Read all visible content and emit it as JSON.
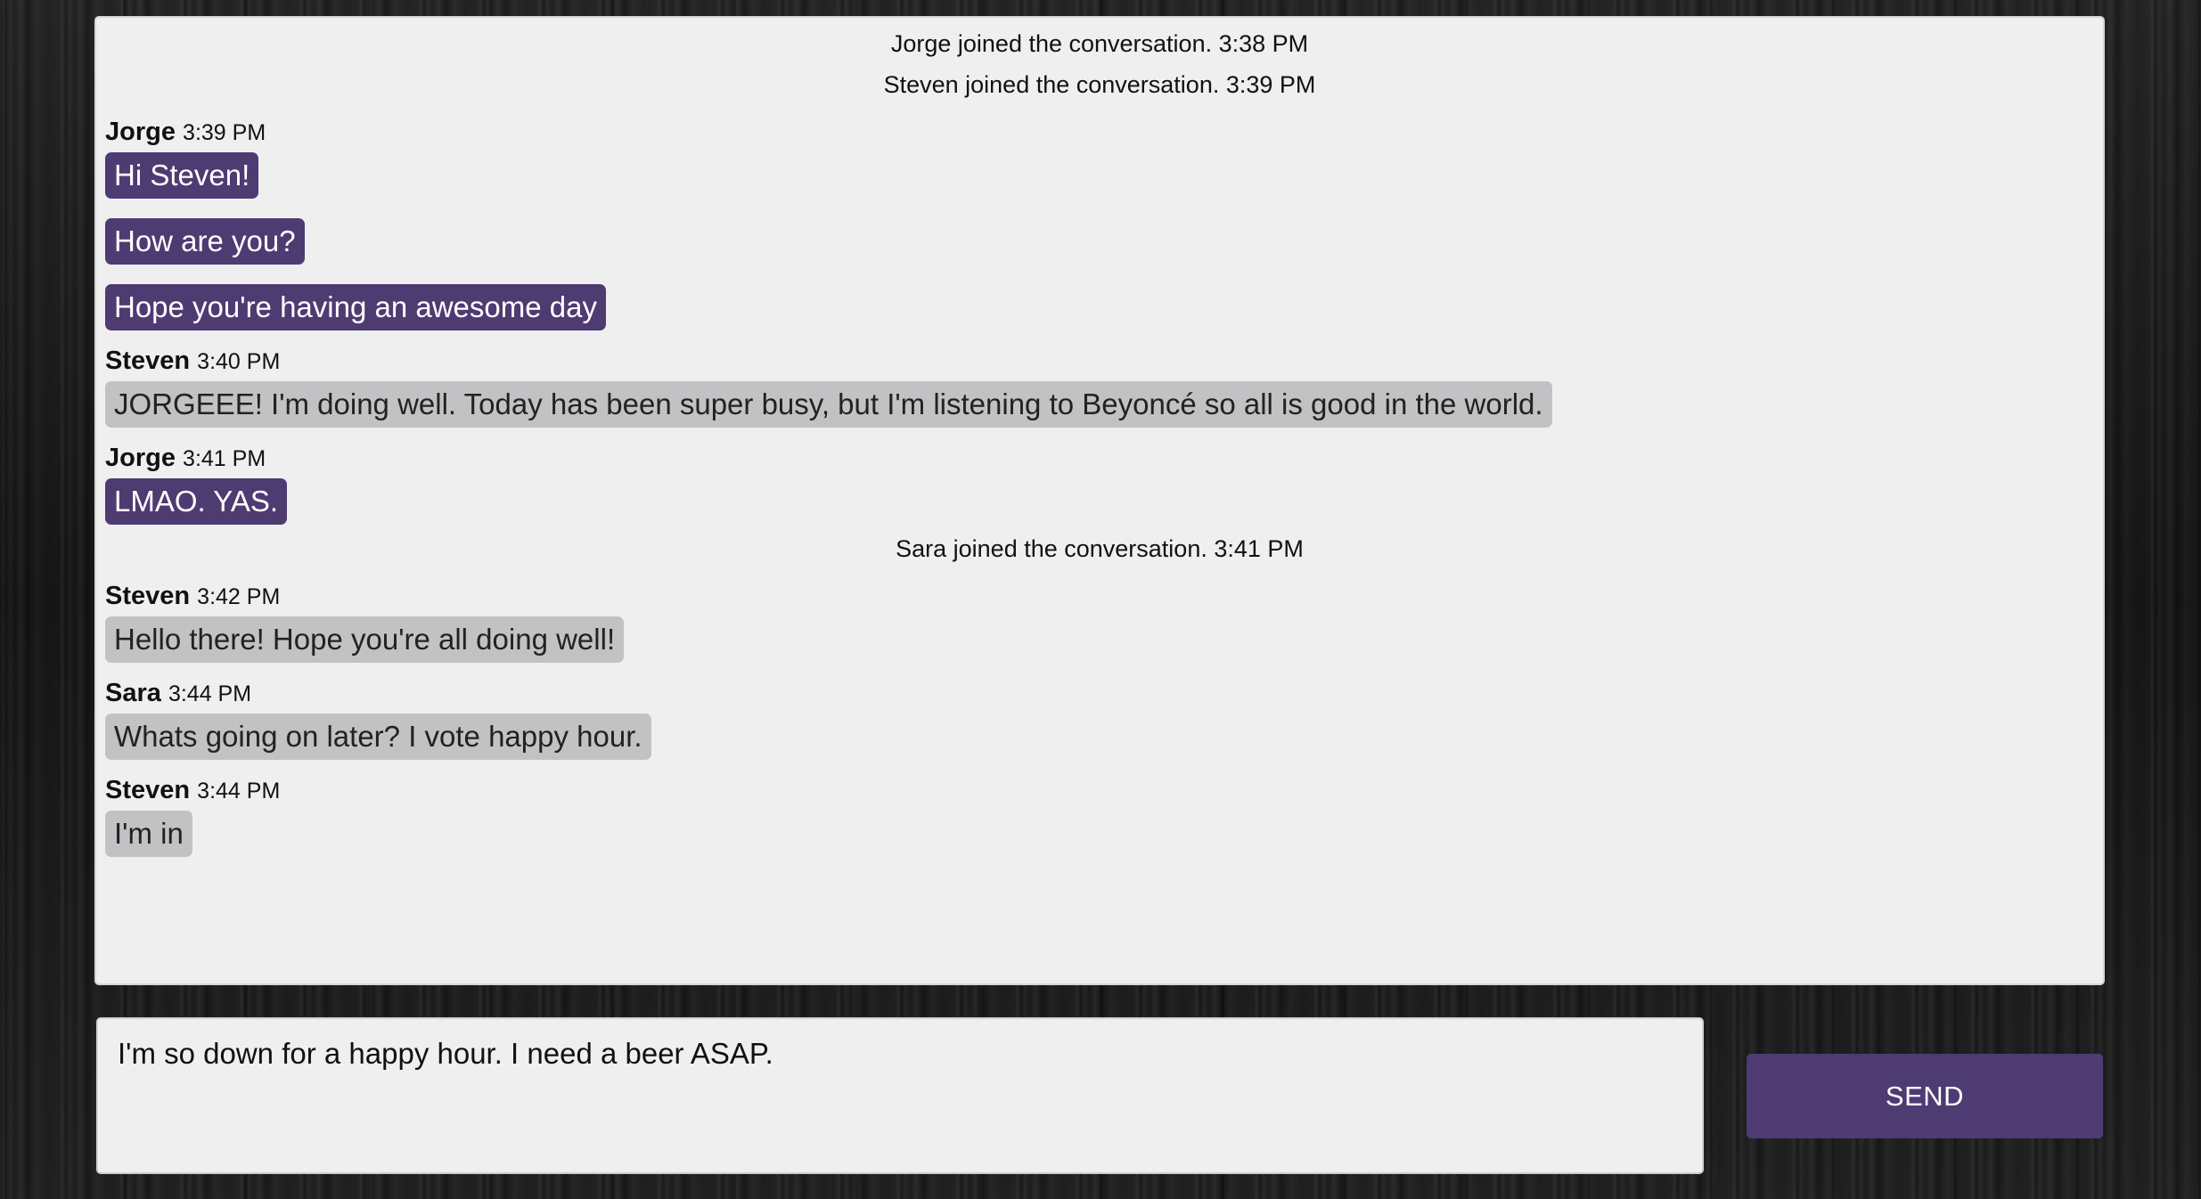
{
  "conversation": {
    "system_1": "Jorge joined the conversation. 3:38 PM",
    "system_2": "Steven joined the conversation. 3:39 PM",
    "group_1": {
      "author": "Jorge",
      "time": "3:39 PM",
      "messages": [
        "Hi Steven!",
        "How are you?",
        "Hope you're having an awesome day"
      ]
    },
    "group_2": {
      "author": "Steven",
      "time": "3:40 PM",
      "messages": [
        "JORGEEE! I'm doing well. Today has been super busy, but I'm listening to Beyoncé so all is good in the world."
      ]
    },
    "group_3": {
      "author": "Jorge",
      "time": "3:41 PM",
      "messages": [
        "LMAO. YAS."
      ]
    },
    "system_3": "Sara joined the conversation. 3:41 PM",
    "group_4": {
      "author": "Steven",
      "time": "3:42 PM",
      "messages": [
        "Hello there! Hope you're all doing well!"
      ]
    },
    "group_5": {
      "author": "Sara",
      "time": "3:44 PM",
      "messages": [
        "Whats going on later? I vote happy hour."
      ]
    },
    "group_6": {
      "author": "Steven",
      "time": "3:44 PM",
      "messages": [
        "I'm in"
      ]
    }
  },
  "composer": {
    "value": "I'm so down for a happy hour. I need a beer ASAP.",
    "send_label": "SEND"
  },
  "colors": {
    "own_bubble": "#4e3b72",
    "other_bubble": "#c2c1c4",
    "send_button": "#4e3b72"
  }
}
